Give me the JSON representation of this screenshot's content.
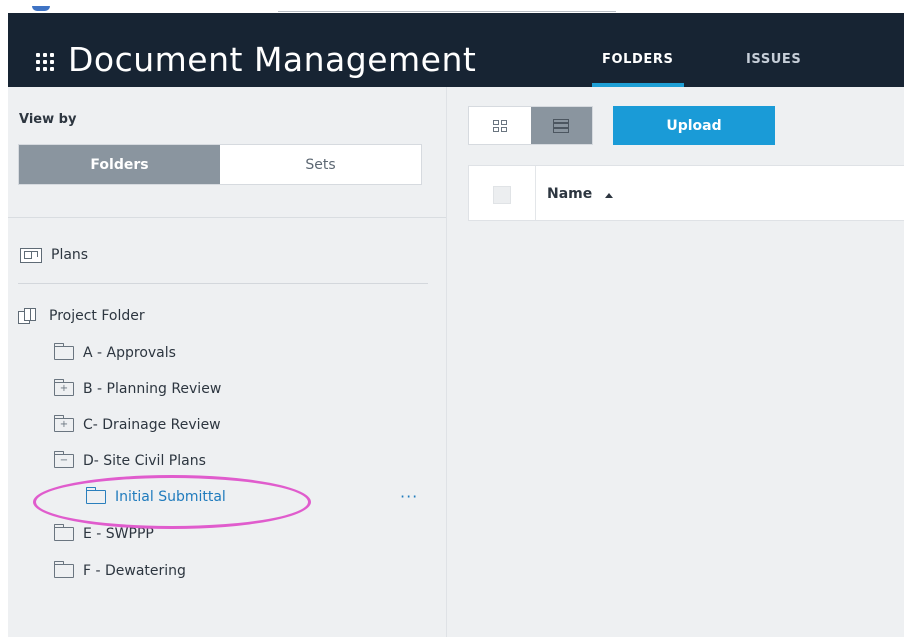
{
  "header": {
    "title": "Document Management",
    "tabs": [
      {
        "label": "FOLDERS",
        "active": true
      },
      {
        "label": "ISSUES",
        "active": false
      }
    ],
    "accent_color": "#1e9fd5",
    "background_color": "#172433"
  },
  "left_panel": {
    "view_by_label": "View by",
    "segments": [
      {
        "label": "Folders",
        "active": true
      },
      {
        "label": "Sets",
        "active": false
      }
    ],
    "plans_label": "Plans",
    "project_folder_label": "Project Folder",
    "folders": [
      {
        "label": "A - Approvals",
        "state": "none"
      },
      {
        "label": "B - Planning Review",
        "state": "collapsed"
      },
      {
        "label": "C- Drainage Review",
        "state": "collapsed"
      },
      {
        "label": "D- Site Civil Plans",
        "state": "expanded"
      },
      {
        "label": "Initial Submittal",
        "state": "selected",
        "more_label": "···"
      },
      {
        "label": "E - SWPPP",
        "state": "none"
      },
      {
        "label": "F - Dewatering",
        "state": "none"
      }
    ],
    "highlight_color": "#e05ccd",
    "selected_color": "#1f7bbd"
  },
  "right_panel": {
    "view_modes": [
      {
        "icon": "grid-view-icon",
        "active": false
      },
      {
        "icon": "list-view-icon",
        "active": true
      }
    ],
    "upload_label": "Upload",
    "upload_color": "#1a9bd7",
    "table": {
      "columns": [
        {
          "label": "Name",
          "sort": "ascending"
        }
      ],
      "rows": []
    }
  }
}
